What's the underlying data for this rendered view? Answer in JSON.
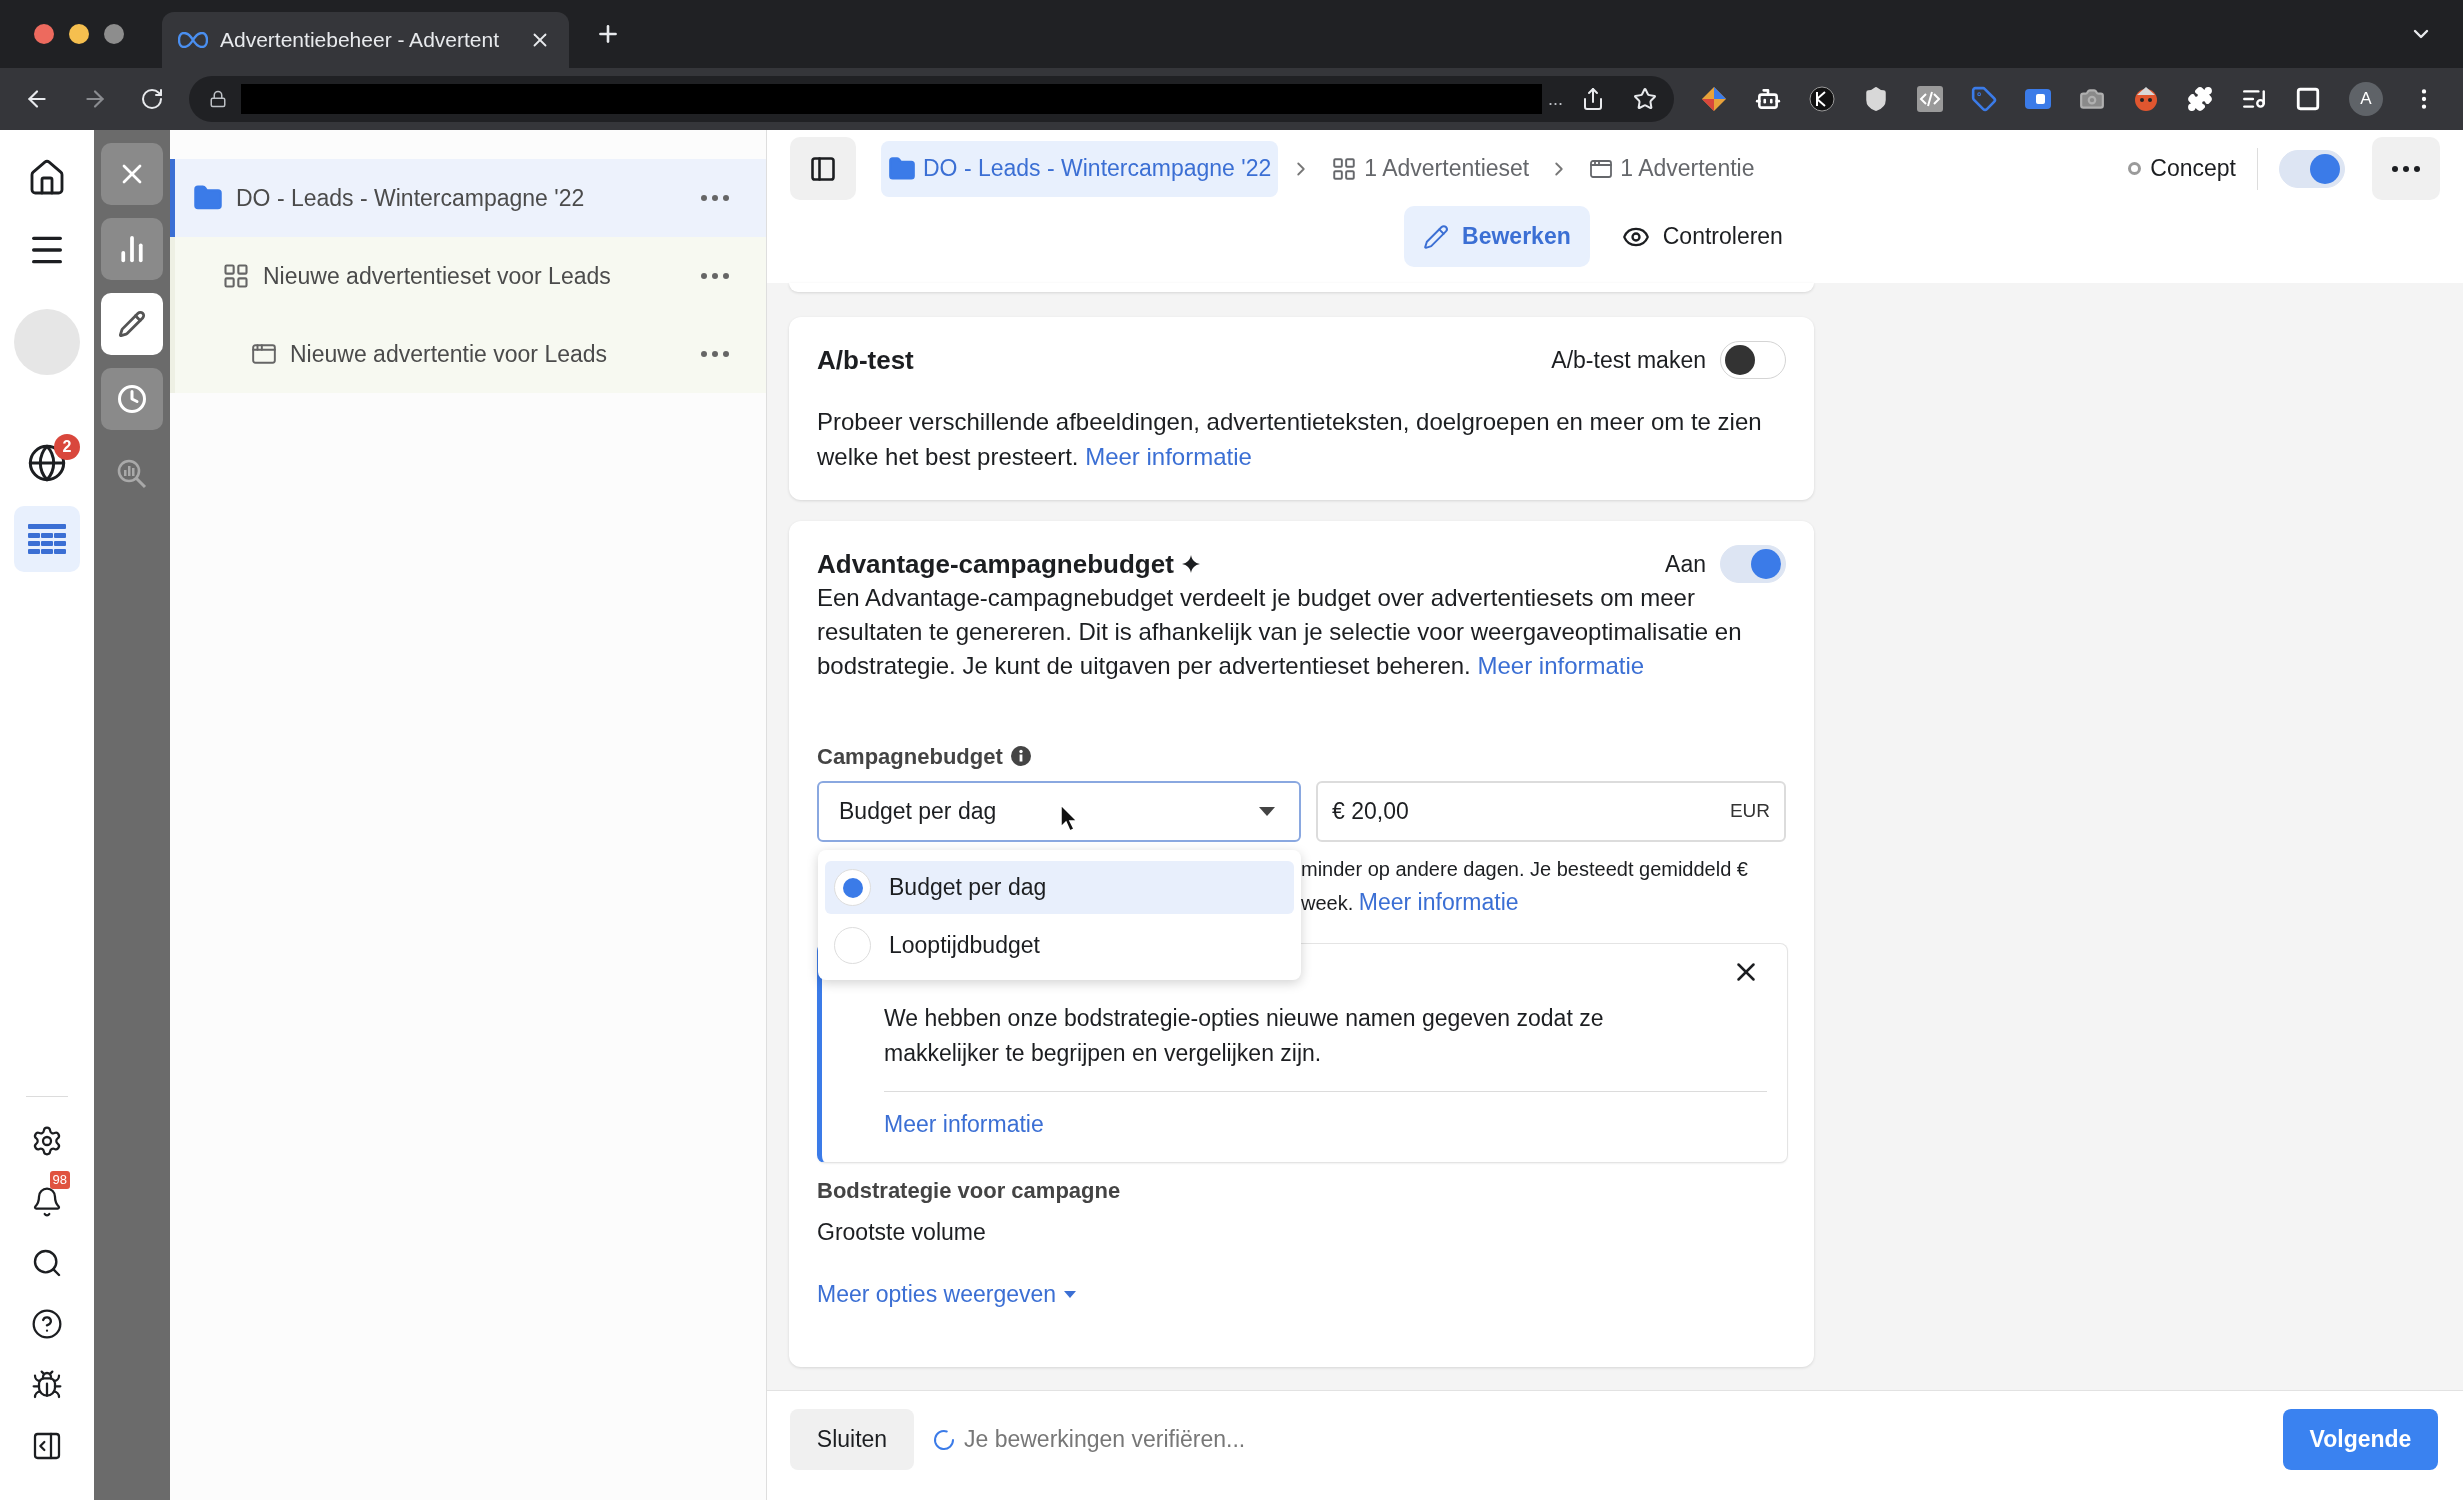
{
  "browser": {
    "tab_title": "Advertentiebeheer - Advertent",
    "url_tail": "...",
    "profile_initial": "A"
  },
  "left_nav": {
    "top": [
      {
        "kind": "home",
        "selected": false
      },
      {
        "kind": "menu",
        "selected": false
      },
      {
        "kind": "avatar",
        "selected": false
      },
      {
        "kind": "globe",
        "selected": false,
        "badge": "2"
      },
      {
        "kind": "table",
        "selected": true
      }
    ],
    "bottom": [
      {
        "kind": "settings",
        "selected": false
      },
      {
        "kind": "bell",
        "selected": false,
        "badge": "98"
      },
      {
        "kind": "search",
        "selected": false
      },
      {
        "kind": "help",
        "selected": false
      },
      {
        "kind": "bug",
        "selected": false
      },
      {
        "kind": "panel",
        "selected": false
      }
    ]
  },
  "tool_rail": [
    {
      "kind": "close",
      "selected": false
    },
    {
      "kind": "chart",
      "selected": false
    },
    {
      "kind": "edit",
      "selected": true
    },
    {
      "kind": "history",
      "selected": false
    },
    {
      "kind": "insights",
      "selected": false
    }
  ],
  "tree": [
    {
      "kind": "campaign",
      "label": "DO - Leads - Wintercampagne '22",
      "selected": true,
      "children": [
        {
          "kind": "adset",
          "label": "Nieuwe advertentieset voor Leads",
          "selected": false,
          "children": [
            {
              "kind": "ad",
              "label": "Nieuwe advertentie voor Leads",
              "selected": false
            }
          ]
        }
      ]
    }
  ],
  "header": {
    "breadcrumb": [
      {
        "kind": "campaign",
        "label": "DO - Leads - Wintercampagne '22",
        "selected": true
      },
      {
        "kind": "adset",
        "label": "1 Advertentieset",
        "selected": false
      },
      {
        "kind": "ad",
        "label": "1 Advertentie",
        "selected": false
      }
    ],
    "status_label": "Concept",
    "toggle_on": true,
    "modes": [
      {
        "kind": "edit",
        "label": "Bewerken",
        "selected": true
      },
      {
        "kind": "review",
        "label": "Controleren",
        "selected": false
      }
    ]
  },
  "ab_test": {
    "title": "A/b-test",
    "toggle_label": "A/b-test maken",
    "on": false,
    "description": "Probeer verschillende afbeeldingen, advertentieteksten, doelgroepen en meer om te zien welke het best presteert.",
    "link": "Meer informatie"
  },
  "budget": {
    "title": "Advantage-campagnebudget",
    "toggle_label": "Aan",
    "on": true,
    "description": "Een Advantage-campagnebudget verdeelt je budget over advertentiesets om meer resultaten te genereren. Dit is afhankelijk van je selectie voor weergaveoptimalisatie en bodstrategie. Je kunt de uitgaven per advertentieset beheren.",
    "link": "Meer informatie",
    "field_label": "Campagnebudget",
    "select": {
      "value": "Budget per dag",
      "expanded": true,
      "options": [
        {
          "label": "Budget per dag",
          "selected": true
        },
        {
          "label": "Looptijdbudget",
          "selected": false
        }
      ]
    },
    "amount": {
      "value": "€ 20,00",
      "currency": "EUR"
    },
    "hint_lines": [
      "minder op andere dagen. Je besteedt gemiddeld €",
      "week."
    ],
    "hint_link": "Meer informatie",
    "notice": {
      "text": "We hebben onze bodstrategie-opties nieuwe namen gegeven zodat ze makkelijker te begrijpen en vergelijken zijn.",
      "link": "Meer informatie"
    },
    "bid_strategy": {
      "label": "Bodstrategie voor campagne",
      "value": "Grootste volume"
    },
    "more_link": "Meer opties weergeven"
  },
  "footer": {
    "close": "Sluiten",
    "status": "Je bewerkingen verifiëren...",
    "next": "Volgende"
  }
}
